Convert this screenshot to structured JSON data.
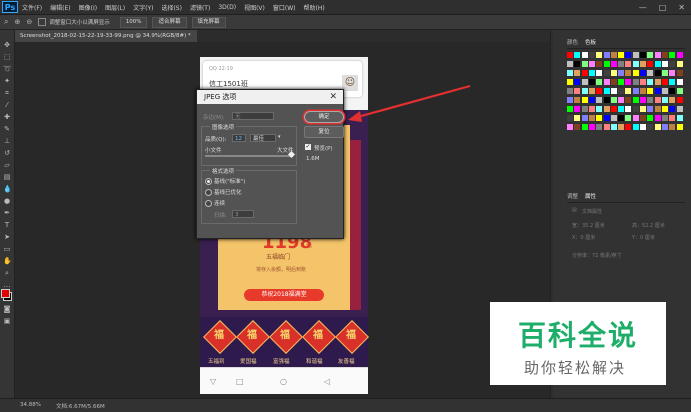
{
  "menubar": {
    "items": [
      "文件(F)",
      "编辑(E)",
      "图像(I)",
      "图层(L)",
      "文字(Y)",
      "选择(S)",
      "滤镜(T)",
      "3D(D)",
      "视图(V)",
      "窗口(W)",
      "帮助(H)"
    ],
    "window_controls": [
      "—",
      "□",
      "✕"
    ]
  },
  "options_bar": {
    "checkbox_label": "调整窗口大小以满屏显示",
    "zoom_value": "100%",
    "fit_screen": "适合屏幕",
    "fill_screen": "填充屏幕"
  },
  "document_tab": {
    "label": "Screenshot_2018-02-15-22-19-33-99.png @ 34.9%(RGB/8#) *"
  },
  "phone": {
    "qq_time": "QQ 22:19",
    "qq_title": "信工1501班",
    "price": "1198",
    "price_unit": "元",
    "blessing": "五福临门",
    "blessing_sub": "将存入余额，明后到账",
    "poster_button": "恭祝2018福满堂",
    "fu_cards": [
      {
        "glyph": "福",
        "label": "五福到"
      },
      {
        "glyph": "福",
        "label": "爱国福"
      },
      {
        "glyph": "福",
        "label": "富强福"
      },
      {
        "glyph": "福",
        "label": "和谐福"
      },
      {
        "glyph": "福",
        "label": "友善福"
      }
    ],
    "nav_icons": [
      "▽",
      "□",
      "○",
      "◁"
    ]
  },
  "jpeg_dialog": {
    "title": "JPEG 选项",
    "close": "✕",
    "matte_label": "杂边(M):",
    "matte_value": "无",
    "image_options_label": "图像选项",
    "quality_label": "品质(Q):",
    "quality_value": "12",
    "quality_preset": "最佳",
    "small_file": "小文件",
    "large_file": "大文件",
    "quality_fraction": 1.0,
    "format_options_label": "格式选项",
    "format_options": [
      {
        "label": "基线(\"标准\")",
        "selected": true
      },
      {
        "label": "基线已优化",
        "selected": false
      },
      {
        "label": "连续",
        "selected": false
      }
    ],
    "scan_label": "扫描:",
    "scan_value": "3",
    "ok_button": "确定",
    "reset_button": "复位",
    "preview_label": "预览(P)",
    "preview_checked": true,
    "file_size": "1.6M"
  },
  "right_panels": {
    "color_tab": "颜色",
    "swatches_tab": "色板",
    "adjust_tab": "调整",
    "properties_tab": "属性",
    "properties_doc": "文档属性",
    "props": [
      "宽：35.2 厘米",
      "高：52.2 厘米",
      "X：0 厘米",
      "Y：0 厘米"
    ],
    "resolution": "分辨率：72 像素/英寸"
  },
  "swatch_colors": [
    "#ff0000",
    "#ffff00",
    "#00ff00",
    "#00ffff",
    "#0000ff",
    "#ff00ff",
    "#ffffff",
    "#c0c0c0",
    "#808080",
    "#404040",
    "#000000",
    "#ff8080",
    "#ffff80",
    "#80ff80",
    "#80ffff",
    "#8080ff",
    "#ff80ff",
    "#e0a060",
    "#c08040",
    "#804020"
  ],
  "status_bar": {
    "zoom": "34.88%",
    "doc": "文档:6.67M/5.66M"
  },
  "colors": {
    "accent": "#31a8ff",
    "annotation": "#e23030",
    "watermark_green": "#1fae6a"
  },
  "watermark": {
    "title": "百科全说",
    "subtitle": "助你轻松解决"
  }
}
